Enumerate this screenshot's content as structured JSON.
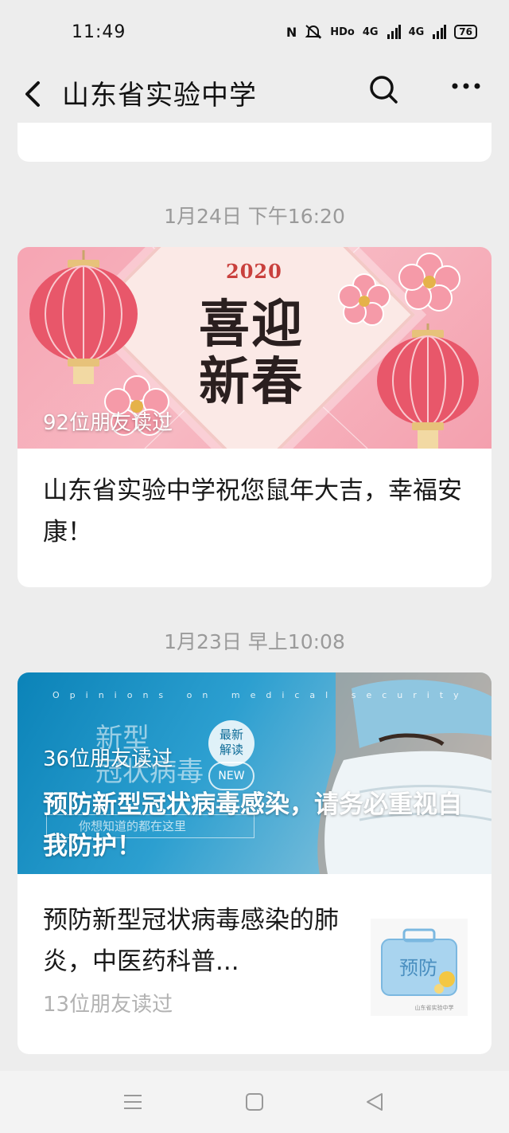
{
  "status": {
    "time": "11:49",
    "network": "HDo",
    "signal_1": "4G",
    "signal_2": "4G",
    "battery": "76"
  },
  "nav": {
    "title": "山东省实验中学",
    "icons": [
      "back-icon",
      "search-icon",
      "more-icon"
    ]
  },
  "feed": {
    "group_1": {
      "timestamp": "1月24日 下午16:20",
      "cover": {
        "year": "2020",
        "headline_line1": "喜迎",
        "headline_line2": "新春"
      },
      "reads": "92位朋友读过",
      "title": "山东省实验中学祝您鼠年大吉，幸福安康！"
    },
    "group_2": {
      "timestamp": "1月23日 早上10:08",
      "cover": {
        "english": "Opinions on medical security",
        "decor_line1": "新型",
        "decor_line2": "冠状病毒",
        "badge_line1": "最新",
        "badge_line2": "解读",
        "badge_new": "NEW",
        "subline": "你想知道的都在这里"
      },
      "reads": "36位朋友读过",
      "title": "预防新型冠状病毒感染，请务必重视自我防护！",
      "sub_article": {
        "title": "预防新型冠状病毒感染的肺炎，中医药科普...",
        "reads": "13位朋友读过",
        "thumb_text": "预防",
        "thumb_caption": "山东省实验中学"
      }
    }
  },
  "colors": {
    "background": "#ededed",
    "card": "#ffffff",
    "timestamp": "#9a9a9a",
    "reads_gray": "#b2b2b2"
  }
}
